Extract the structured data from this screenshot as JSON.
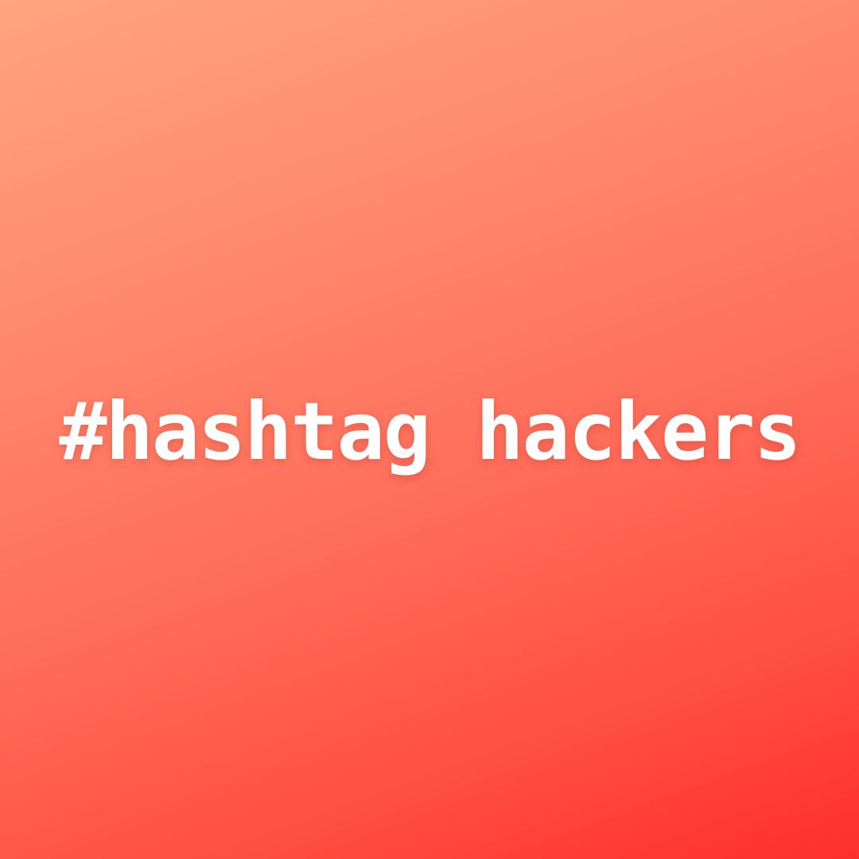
{
  "headline": "#hashtag hackers",
  "colors": {
    "gradient_start": "#ffa47f",
    "gradient_end": "#ff2e2e",
    "text": "#ffffff"
  }
}
